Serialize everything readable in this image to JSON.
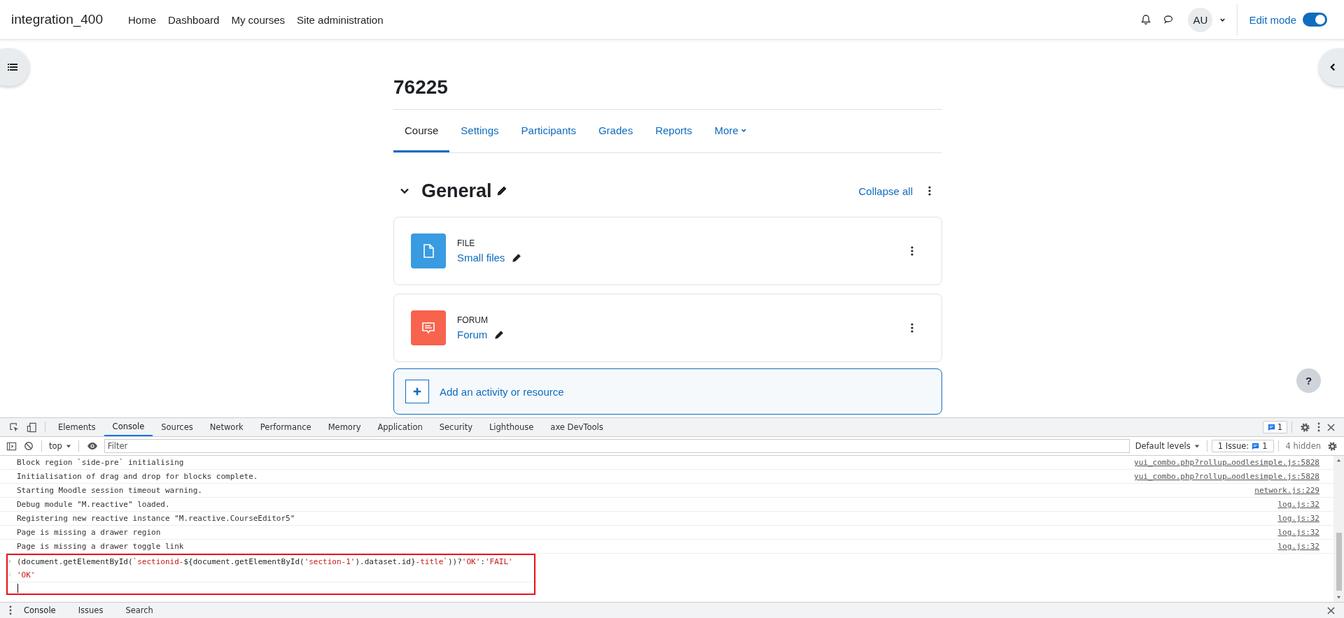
{
  "navbar": {
    "site_name": "integration_400",
    "links": [
      "Home",
      "Dashboard",
      "My courses",
      "Site administration"
    ],
    "avatar_initials": "AU",
    "edit_mode": {
      "label": "Edit mode",
      "on": true
    }
  },
  "course": {
    "title": "76225",
    "tabs": [
      {
        "label": "Course",
        "selected": true
      },
      {
        "label": "Settings",
        "selected": false
      },
      {
        "label": "Participants",
        "selected": false
      },
      {
        "label": "Grades",
        "selected": false
      },
      {
        "label": "Reports",
        "selected": false
      },
      {
        "label": "More",
        "selected": false
      }
    ],
    "section": {
      "title": "General",
      "expanded": true,
      "collapse_label": "Collapse all"
    },
    "activities": [
      {
        "kind": "file",
        "type_label": "FILE",
        "name": "Small files"
      },
      {
        "kind": "forum",
        "type_label": "FORUM",
        "name": "Forum"
      }
    ],
    "add_label": "Add an activity or resource"
  },
  "help_label": "?",
  "devtools": {
    "tabs": [
      {
        "label": "Elements",
        "selected": false
      },
      {
        "label": "Console",
        "selected": true
      },
      {
        "label": "Sources",
        "selected": false
      },
      {
        "label": "Network",
        "selected": false
      },
      {
        "label": "Performance",
        "selected": false
      },
      {
        "label": "Memory",
        "selected": false
      },
      {
        "label": "Application",
        "selected": false
      },
      {
        "label": "Security",
        "selected": false
      },
      {
        "label": "Lighthouse",
        "selected": false
      },
      {
        "label": "axe DevTools",
        "selected": false
      }
    ],
    "message_count": "1",
    "context": "top",
    "filter_placeholder": "Filter",
    "levels": "Default levels",
    "issues_label": "1 Issue:",
    "issues_count": "1",
    "hidden": "4 hidden",
    "logs": [
      {
        "message": "Block region `side-pre` initialising",
        "source": "yui_combo.php?rollup…oodlesimple.js:5828"
      },
      {
        "message": "Initialisation of drag and drop for blocks complete.",
        "source": "yui_combo.php?rollup…oodlesimple.js:5828"
      },
      {
        "message": "Starting Moodle session timeout warning.",
        "source": "network.js:229"
      },
      {
        "message": "Debug module \"M.reactive\" loaded.",
        "source": "log.js:32"
      },
      {
        "message": "Registering new reactive instance \"M.reactive.CourseEditor5\"",
        "source": "log.js:32"
      },
      {
        "message": "Page is missing a drawer region",
        "source": "log.js:32"
      },
      {
        "message": "Page is missing a drawer toggle link",
        "source": "log.js:32"
      }
    ],
    "evaluation": {
      "highlighted": true,
      "input": [
        {
          "kind": "code",
          "text": "(document.getElementById("
        },
        {
          "kind": "string",
          "text": "`sectionid-"
        },
        {
          "kind": "code",
          "text": "${document.getElementById("
        },
        {
          "kind": "string",
          "text": "'section-1'"
        },
        {
          "kind": "code",
          "text": ").dataset.id}"
        },
        {
          "kind": "string",
          "text": "-title`"
        },
        {
          "kind": "code",
          "text": "))?"
        },
        {
          "kind": "string",
          "text": "'OK'"
        },
        {
          "kind": "code",
          "text": ":"
        },
        {
          "kind": "string",
          "text": "'FAIL'"
        }
      ],
      "result": "'OK'"
    },
    "drawer_tabs": [
      {
        "label": "Console",
        "selected": true
      },
      {
        "label": "Issues",
        "selected": false
      },
      {
        "label": "Search",
        "selected": false
      }
    ]
  }
}
